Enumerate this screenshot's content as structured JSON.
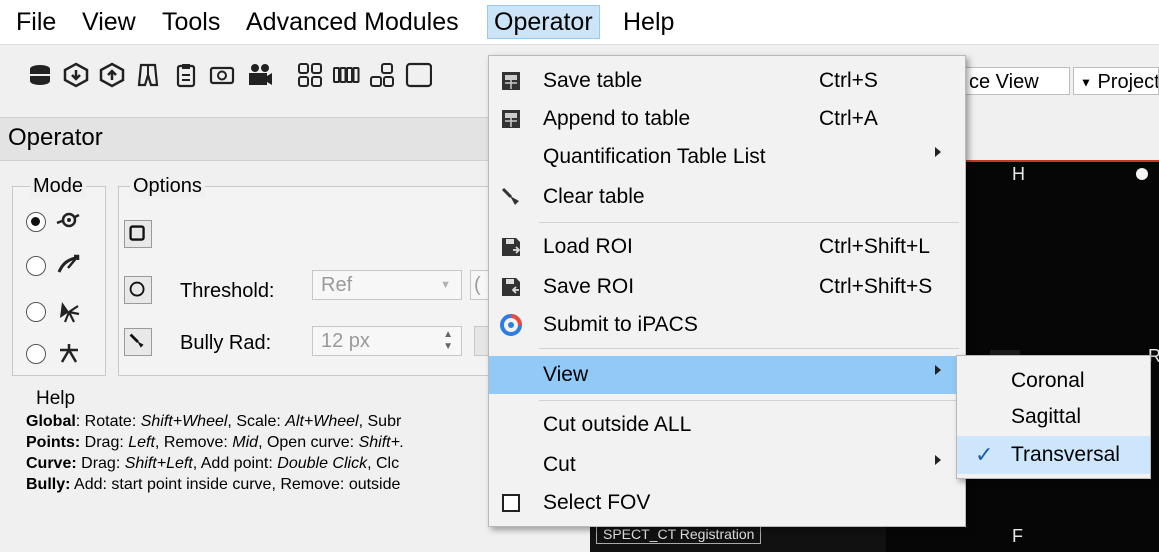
{
  "menubar": {
    "items": [
      "File",
      "View",
      "Tools",
      "Advanced Modules",
      "Operator",
      "Help"
    ]
  },
  "toolbar": {
    "view_combo": "ce View",
    "proj_combo": "Projecti"
  },
  "panel": {
    "title": "Operator",
    "mode_title": "Mode",
    "options_title": "Options",
    "threshold_label": "Threshold:",
    "threshold_value": "Ref",
    "threshold_extra": "(",
    "bully_label": "Bully Rad:",
    "bully_value": "12 px",
    "help_title": "Help",
    "help_lines": [
      {
        "k": "Global",
        "t": ": Rotate: ",
        "a": "Shift+Wheel",
        "t2": ", Scale: ",
        "b": "Alt+Wheel",
        "t3": ", Subr"
      },
      {
        "k": "Points:",
        "t": " Drag: ",
        "a": "Left",
        "t2": ", Remove: ",
        "b": "Mid",
        "t3": ", Open curve: ",
        "c": "Shift+."
      },
      {
        "k": "Curve:",
        "t": " Drag: ",
        "a": "Shift+Left",
        "t2": ", Add point: ",
        "b": "Double Click",
        "t3": ", Clc"
      },
      {
        "k": "Bully:",
        "t": " Add: start point inside curve, Remove: outside"
      }
    ]
  },
  "viewer": {
    "top_label": "H",
    "bottom_label": "F",
    "right_label": "R",
    "caption": "SPECT_CT Registration"
  },
  "dropdown": {
    "items": [
      {
        "label": "Save table",
        "shortcut": "Ctrl+S"
      },
      {
        "label": "Append to table",
        "shortcut": "Ctrl+A"
      },
      {
        "label": "Quantification Table List",
        "shortcut": ""
      },
      {
        "label": "Clear table",
        "shortcut": ""
      },
      {
        "label": "Load ROI",
        "shortcut": "Ctrl+Shift+L"
      },
      {
        "label": "Save ROI",
        "shortcut": "Ctrl+Shift+S"
      },
      {
        "label": "Submit to iPACS",
        "shortcut": ""
      },
      {
        "label": "View",
        "shortcut": ""
      },
      {
        "label": "Cut outside ALL",
        "shortcut": ""
      },
      {
        "label": "Cut",
        "shortcut": ""
      },
      {
        "label": "Select FOV",
        "shortcut": ""
      }
    ]
  },
  "submenu": {
    "items": [
      "Coronal",
      "Sagittal",
      "Transversal"
    ],
    "checked": "Transversal"
  }
}
